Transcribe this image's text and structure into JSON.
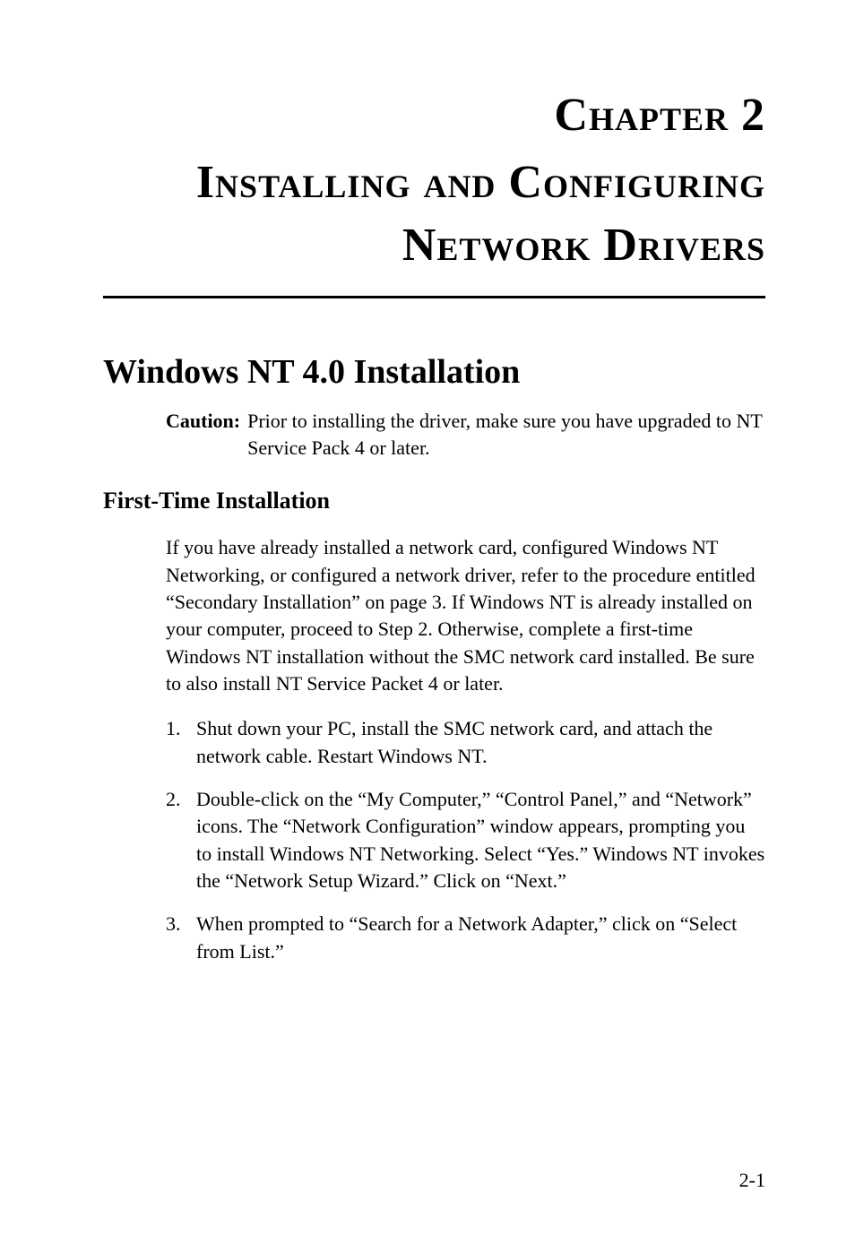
{
  "chapter": {
    "label": "Chapter 2",
    "title_line1": "Installing and Configuring",
    "title_line2": "Network Drivers"
  },
  "section": {
    "heading": "Windows NT 4.0 Installation",
    "caution_label": "Caution:",
    "caution_text": "Prior to installing the driver, make sure you have upgraded to NT Service Pack 4 or later."
  },
  "subsection": {
    "heading": "First-Time Installation",
    "intro": "If you have already installed a network card, configured Windows NT Networking, or configured a network driver, refer to the procedure entitled “Secondary Installation” on page 3. If Windows NT is already installed on your computer, proceed to Step 2. Otherwise, complete a first-time Windows NT installation without the SMC network card installed. Be sure to also install NT Service Packet 4 or later.",
    "steps": [
      "Shut down your PC, install the SMC network card, and attach the network cable. Restart Windows NT.",
      "Double-click on the “My Computer,” “Control Panel,” and “Network” icons. The “Network Configuration” window appears, prompting you to install Windows NT Networking. Select “Yes.” Windows NT invokes the “Network Setup Wizard.” Click on “Next.”",
      "When prompted to “Search for a Network Adapter,” click on “Select from List.”"
    ]
  },
  "page_number": "2-1"
}
